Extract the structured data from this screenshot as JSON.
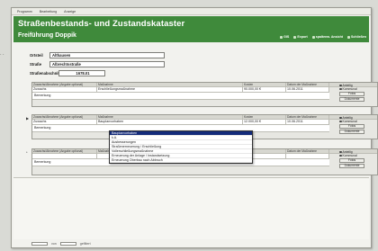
{
  "menu": {
    "items": [
      "Programm",
      "Bearbeitung",
      "Anzeige"
    ]
  },
  "header": {
    "title": "Straßenbestands- und Zustandskataster",
    "subtitle": "Freiführung Doppik",
    "links": [
      "GIS",
      "Export",
      "spaltenw. Ansicht",
      "Schließen"
    ]
  },
  "meta": {
    "ortsteil_label": "Ortsteil",
    "ortsteil_value": "Althausen",
    "strasse_label": "Straße",
    "strasse_value": "Albrechtsstraße",
    "abschnitt_label": "Straßenabschnitt",
    "abschnitt_value": "1678.01"
  },
  "records": [
    {
      "headers": [
        "Zuwachs/Abnahme (Angabe optional)",
        "Maßnahme",
        "Kosten",
        "Datum der Maßnahme"
      ],
      "cells": [
        "Zuwachs",
        "Erschließungsmaßnahme",
        "90.000,00 €",
        "10.06.2011"
      ],
      "note_label": "Bemerkung",
      "radios": [
        "Anteilig",
        "Kommunal"
      ],
      "buttons": [
        "Fotos",
        "Dokumente"
      ]
    },
    {
      "headers": [
        "Zuwachs/Abnahme (Angabe optional)",
        "Maßnahme",
        "Kosten",
        "Datum der Maßnahme"
      ],
      "cells": [
        "Zuwachs",
        "Bauplanvorhaben",
        "12.000,00 €",
        "10.06.2011"
      ],
      "note_label": "Bemerkung",
      "radios": [
        "Anteilig",
        "Kommunal"
      ],
      "buttons": [
        "Fotos",
        "Dokumente"
      ]
    },
    {
      "headers": [
        "Zuwachs/Abnahme (Angabe optional)",
        "Maßnahme",
        "Kosten",
        "Datum der Maßnahme"
      ],
      "cells": [
        "",
        "",
        "",
        ""
      ],
      "note_label": "Bemerkung",
      "radios": [
        "Anteilig",
        "Kommunal"
      ],
      "buttons": [
        "Fotos",
        "Dokumente"
      ]
    }
  ],
  "dropdown": {
    "options": [
      "Bauplanvorhaben",
      "k.A.",
      "Ausbesserungen",
      "Straßenerneuerung / Erschließung",
      "Vollerschließungsmaßnahme",
      "Erneuerung der Anlage / Instandsetzung",
      "Erneuerung Oberbau nach Abbruch"
    ],
    "selected_index": 0
  },
  "footer": {
    "left": "von",
    "mid": "gefiltert"
  }
}
